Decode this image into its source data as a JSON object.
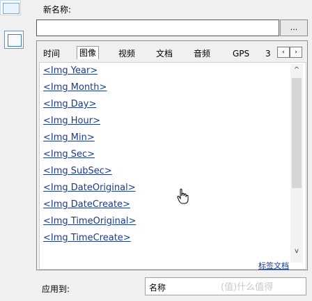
{
  "header": {
    "new_name_label": "新名称:",
    "ellipsis_label": "..."
  },
  "tabs": [
    {
      "label": "时间"
    },
    {
      "label": "图像"
    },
    {
      "label": "视频"
    },
    {
      "label": "文档"
    },
    {
      "label": "音频"
    },
    {
      "label": "GPS"
    },
    {
      "label": "3"
    }
  ],
  "tab_scroll": {
    "left": "‹",
    "right": "›"
  },
  "list": {
    "items": [
      "<Img Year>",
      "<Img Month>",
      "<Img Day>",
      "<Img Hour>",
      "<Img Min>",
      "<Img Sec>",
      "<Img SubSec>",
      "<Img DateOriginal>",
      "<Img DateCreate>",
      "<Img TimeOriginal>",
      "<Img TimeCreate>"
    ]
  },
  "scrollbar": {
    "up": "^",
    "down": "v"
  },
  "doc_link": "标签文档",
  "footer": {
    "apply_to_label": "应用到:",
    "apply_to_value": "名称",
    "watermark": "(值)什么值得"
  },
  "icons": {
    "cursor": "hand-pointer-icon"
  }
}
